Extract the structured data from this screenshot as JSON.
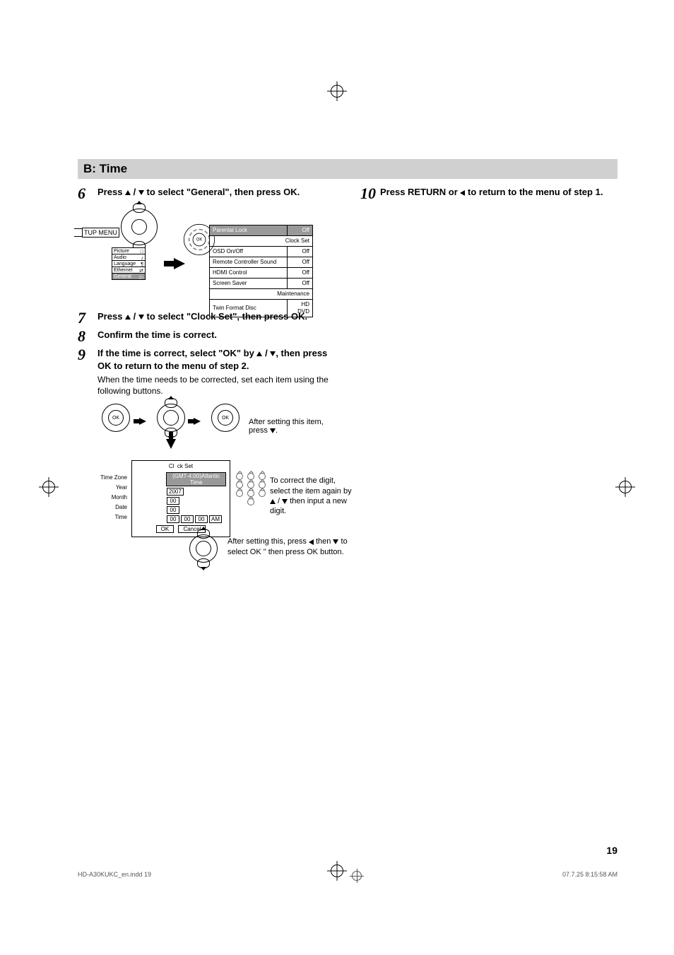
{
  "section_header": "B: Time",
  "steps": {
    "s6": {
      "num": "6",
      "bold": "Press ▲ / ▼ to select \"General\", then press OK."
    },
    "s7": {
      "num": "7",
      "bold": "Press ▲ / ▼ to select \"Clock Set\", then press OK."
    },
    "s8": {
      "num": "8",
      "bold": "Confirm the time is correct."
    },
    "s9": {
      "num": "9",
      "bold": "If the time is correct, select \"OK\" by ▲ / ▼, then press OK to return to the menu of step 2.",
      "plain": "When the time needs to be corrected, set each item using the following buttons."
    },
    "s10": {
      "num": "10",
      "bold": "Press RETURN or ◀ to return to the menu of step 1."
    }
  },
  "setup_menu": {
    "label": "TUP MENU",
    "items": [
      {
        "label": "Picture",
        "icon": "□"
      },
      {
        "label": "Audio",
        "icon": "♪"
      },
      {
        "label": "Language",
        "icon": "¶"
      },
      {
        "label": "Ethernet",
        "icon": "⇄"
      },
      {
        "label": "General",
        "icon": "▷",
        "selected": true
      }
    ],
    "settings": [
      {
        "name": "Parental Lock",
        "value": "Off",
        "selected": true
      },
      {
        "name": "Clock Set",
        "value": ""
      },
      {
        "name": "OSD On/Off",
        "value": "Off"
      },
      {
        "name": "Remote Controller Sound",
        "value": "Off"
      },
      {
        "name": "HDMI Control",
        "value": "Off"
      },
      {
        "name": "Screen Saver",
        "value": "Off"
      },
      {
        "name": "Maintenance",
        "value": ""
      },
      {
        "name": "Twin Format Disc",
        "value": "HD DVD"
      }
    ],
    "dpad_ok": "OK"
  },
  "clock_fig": {
    "after_setting_item": "After setting this item, press ▼.",
    "box_title": "Clock Set",
    "labels": {
      "tz": "Time Zone",
      "year": "Year",
      "month": "Month",
      "date": "Date",
      "time": "Time"
    },
    "values": {
      "tz": "(GMT-4:00)Atlantic Time",
      "year": "2007",
      "month": "00",
      "date": "00",
      "time_h": "00",
      "time_m": "00",
      "time_s": "00",
      "time_ap": "AM"
    },
    "buttons": {
      "ok": "OK",
      "cancel": "Cancel"
    },
    "correct_note": "To correct the digit, select the item again by ▲ / ▼ then input a new digit.",
    "after_setting_this": "After setting this, press ◀ then ▼ to select OK \" then press OK button.",
    "dpad_ok": "OK"
  },
  "page_number": "19",
  "footer": {
    "left": "HD-A30KUKC_en.indd   19",
    "right": "07.7.25   8:15:58 AM"
  }
}
